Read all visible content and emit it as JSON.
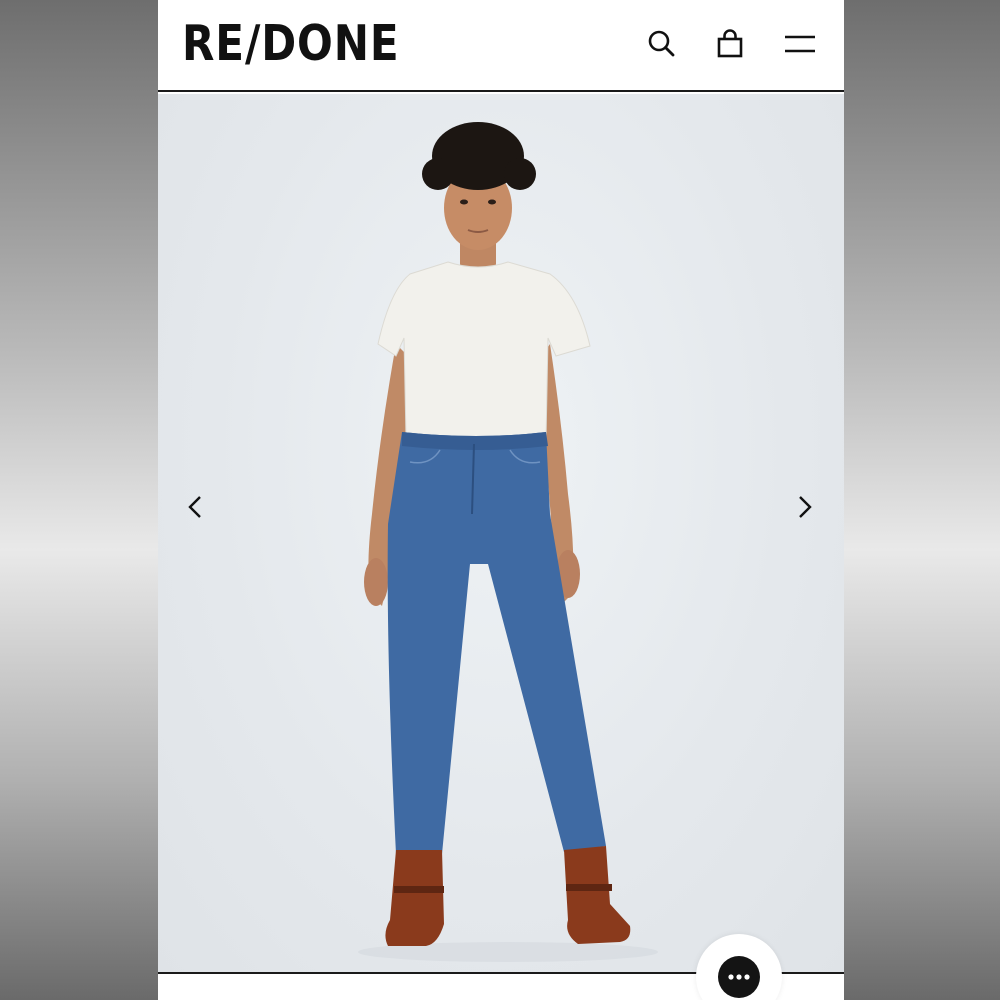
{
  "header": {
    "logo_text": "RE/DONE",
    "search_icon": "search-icon",
    "bag_icon": "shopping-bag-icon",
    "menu_icon": "hamburger-menu-icon"
  },
  "gallery": {
    "image_subject": "model-white-tee-blue-straight-jeans-brown-boots",
    "prev_icon": "chevron-left-icon",
    "next_icon": "chevron-right-icon"
  },
  "chat": {
    "icon": "chat-ellipsis-icon"
  },
  "colors": {
    "text": "#111111",
    "background": "#ffffff",
    "stage": "#e4e8ec",
    "denim": "#3f6aa3",
    "boots": "#8a3a1c",
    "chat": "#141414"
  }
}
